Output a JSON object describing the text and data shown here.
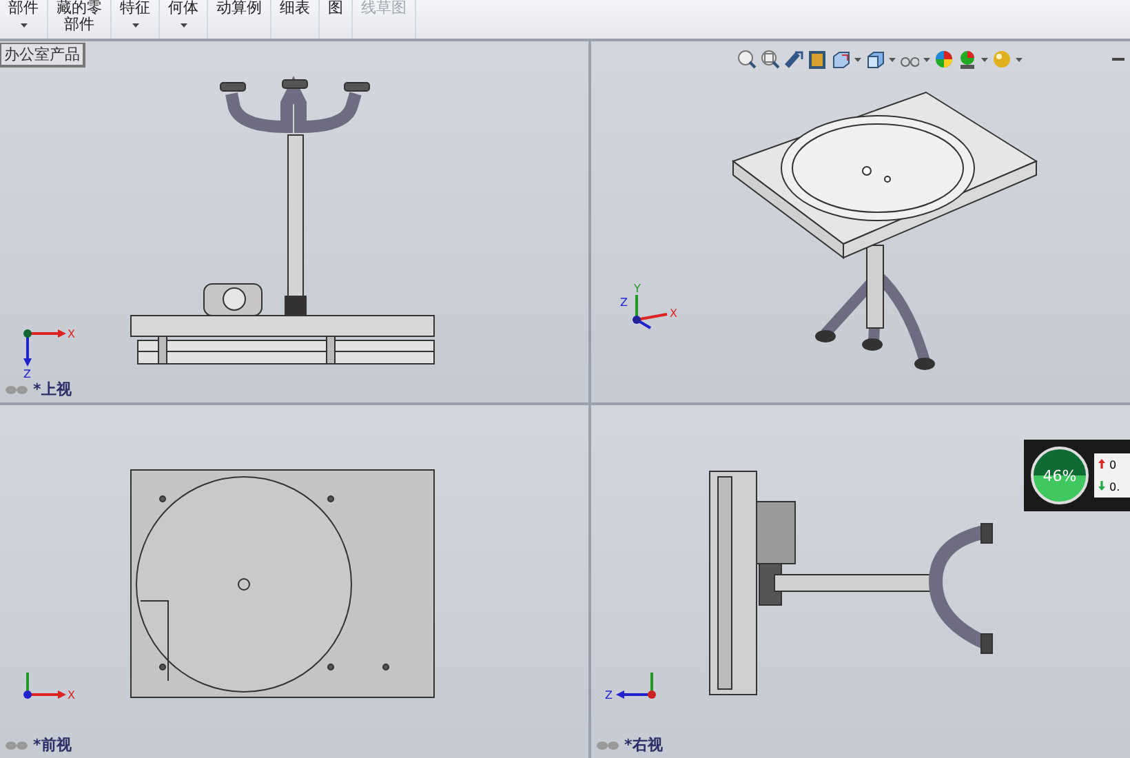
{
  "toolbar": {
    "items": [
      {
        "lines": [
          "部件"
        ],
        "dropdown": true,
        "disabled": false
      },
      {
        "lines": [
          "藏的零",
          "部件"
        ],
        "dropdown": false,
        "disabled": false
      },
      {
        "lines": [
          "特征"
        ],
        "dropdown": true,
        "disabled": false
      },
      {
        "lines": [
          "何体"
        ],
        "dropdown": true,
        "disabled": false
      },
      {
        "lines": [
          "动算例"
        ],
        "dropdown": false,
        "disabled": false
      },
      {
        "lines": [
          "细表"
        ],
        "dropdown": false,
        "disabled": false
      },
      {
        "lines": [
          "图"
        ],
        "dropdown": false,
        "disabled": false
      },
      {
        "lines": [
          "线草图"
        ],
        "dropdown": false,
        "disabled": true
      }
    ]
  },
  "document_tab": "办公室产品",
  "viewports": [
    {
      "kind": "top",
      "label": "*上视",
      "triad": [
        "X",
        "Z"
      ]
    },
    {
      "kind": "iso",
      "triad": [
        "X",
        "Y",
        "Z"
      ]
    },
    {
      "kind": "front",
      "label": "*前视",
      "triad": [
        "X"
      ]
    },
    {
      "kind": "right",
      "label": "*右视",
      "triad": [
        "Z"
      ]
    }
  ],
  "meter": {
    "reading": "46%",
    "up": "0",
    "down": "0."
  }
}
